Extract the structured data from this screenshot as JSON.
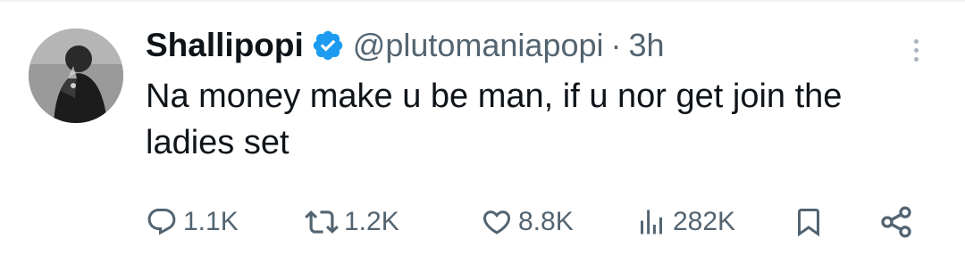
{
  "author": {
    "name": "Shallipopi",
    "handle": "@plutomaniapopi",
    "separator": "·",
    "time": "3h",
    "verified": true
  },
  "tweet": {
    "text": "Na money make u be man, if u nor get join the ladies set"
  },
  "stats": {
    "replies": "1.1K",
    "reposts": "1.2K",
    "likes": "8.8K",
    "views": "282K"
  },
  "icons": {
    "verified": "verified-badge-icon",
    "more": "more-options-icon",
    "reply": "reply-icon",
    "repost": "repost-icon",
    "like": "heart-icon",
    "views": "views-chart-icon",
    "bookmark": "bookmark-icon",
    "share": "share-icon"
  },
  "colors": {
    "text": "#0f1419",
    "secondary": "#536471",
    "verified": "#1d9bf0",
    "divider": "#eff3f4"
  }
}
